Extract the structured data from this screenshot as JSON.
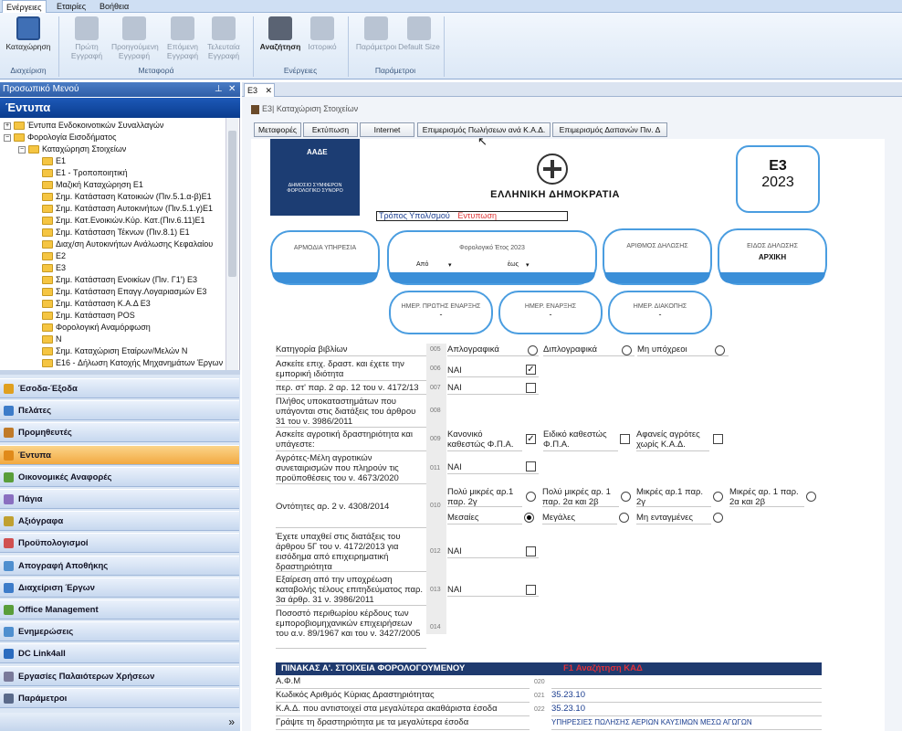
{
  "ribbon": {
    "tabs": [
      "Ενέργειες",
      "Εταιρίες",
      "Βοήθεια"
    ],
    "buttons": {
      "save": "Καταχώρηση",
      "first": "Πρώτη Εγγραφή",
      "prev": "Προηγούμενη Εγγραφή",
      "next": "Επόμενη Εγγραφή",
      "last": "Τελευταία Εγγραφή",
      "search": "Αναζήτηση",
      "history": "Ιστορικό",
      "params": "Παράμετροι",
      "default_size": "Default Size"
    },
    "groups": {
      "management": "Διαχείριση",
      "navigation": "Μεταφορά",
      "actions": "Ενέργειες",
      "parameters": "Παράμετροι"
    }
  },
  "left": {
    "header": "Προσωπικό Μενού",
    "pin": "ᵠ",
    "close": "✕",
    "section": "Έντυπα",
    "tree": {
      "root1": "Έντυπα Ενδοκοινοτικών Συναλλαγών",
      "root2": "Φορολογία Εισοδήματος",
      "sub": "Καταχώρηση Στοιχείων",
      "items": [
        "E1",
        "E1 - Τροποποιητική",
        "Μαζική Καταχώρηση E1",
        "Σημ. Κατάσταση Κατοικιών (Πιν.5.1.α-β)E1",
        "Σημ. Κατάσταση Αυτοκινήτων (Πιν.5.1.γ)E1",
        "Σημ. Κατ.Ενοικιών.Κύρ. Κατ.(Πιν.6.11)E1",
        "Σημ. Κατάσταση Τέκνων (Πιν.8.1) E1",
        "Διαχ/ση Αυτοκινήτων Ανάλωσης Κεφαλαίου",
        "E2",
        "E3",
        "Σημ. Κατάσταση Ενοικίων (Πιν. Γ1') Ε3",
        "Σημ. Κατάσταση Επαγγ.Λογαριασμών Ε3",
        "Σημ. Κατάσταση Κ.Α.Δ Ε3",
        "Σημ. Κατάσταση POS",
        "Φορολογική Αναμόρφωση",
        "N",
        "Σημ. Καταχώριση Εταίρων/Μελών Ν",
        "E16 - Δήλωση Κατοχής Μηχανημάτων Έργων"
      ]
    },
    "nav": [
      "Έσοδα-Έξοδα",
      "Πελάτες",
      "Προμηθευτές",
      "Έντυπα",
      "Οικονομικές Αναφορές",
      "Πάγια",
      "Αξιόγραφα",
      "Προϋπολογισμοί",
      "Απογραφή Αποθήκης",
      "Διαχείριση Έργων",
      "Office Management",
      "Ενημερώσεις",
      "DC Link4all",
      "Εργασίες Παλαιότερων Χρήσεων",
      "Παράμετροι"
    ],
    "bottom_arrow": "»"
  },
  "doc": {
    "tab": "E3",
    "close": "✕",
    "title": "Ε3| Καταχώριση Στοιχείων",
    "toolbar": [
      "Μεταφορές",
      "Εκτύπωση",
      "Internet",
      "Επιμερισμός Πωλήσεων ανά Κ.Α.Δ.",
      "Επιμερισμός Δαπανών Πιν. Δ"
    ]
  },
  "form": {
    "aade": "ΑΑΔΕ",
    "aade_sub": "ΔΗΜΟΣΙΟ ΣΥΜΦΕΡΟΝ ΦΟΡΟΛΟΓΙΚΟ ΣΥΝΟΡΟ",
    "republic": "ΕΛΛΗΝΙΚΗ ΔΗΜΟΚΡΑΤΙΑ",
    "form_code": "Ε3",
    "year": "2023",
    "payment_label": "Τρόπος Υπολ/σμού",
    "payment_value": "Εντυπωση",
    "pills": {
      "service": "ΑΡΜΟΔΙΑ ΥΠΗΡΕΣΙΑ",
      "tax_year": "Φορολογικό Έτος 2023",
      "from": "Από",
      "to": "έως",
      "decl_no": "ΑΡΙΘΜΟΣ ΔΗΛΩΣΗΣ",
      "decl_type": "ΕΙΔΟΣ ΔΗΛΩΣΗΣ",
      "decl_type_val": "ΑΡΧΙΚΗ",
      "start_date": "ΗΜΕΡ. ΠΡΩΤΗΣ ΕΝΑΡΞΗΣ",
      "resume_date": "ΗΜΕΡ. ΕΝΑΡΞΗΣ",
      "stop_date": "ΗΜΕΡ. ΔΙΑΚΟΠΗΣ",
      "dash": "-"
    },
    "rows": {
      "r005": {
        "label": "Κατηγορία βιβλίων",
        "num": "005",
        "opt1": "Απλογραφικά",
        "opt2": "Διπλογραφικά",
        "opt3": "Μη υπόχρεοι"
      },
      "r006": {
        "label": "Ασκείτε επιχ. δραστ. και έχετε την εμπορική ιδιότητα",
        "num": "006",
        "yes": "ΝΑΙ"
      },
      "r007": {
        "label": "περ. στ' παρ. 2 αρ. 12 του ν. 4172/13",
        "num": "007",
        "yes": "ΝΑΙ"
      },
      "r008": {
        "label": "Πλήθος υποκαταστημάτων που υπάγονται στις διατάξεις του άρθρου 31 του ν. 3986/2011",
        "num": "008"
      },
      "r009": {
        "label": "Ασκείτε αγροτική δραστηριότητα και υπάγεστε:",
        "num": "009",
        "opt1": "Κανονικό καθεστώς Φ.Π.Α.",
        "opt2": "Ειδικό καθεστώς Φ.Π.Α.",
        "opt3": "Αφανείς αγρότες χωρίς Κ.Α.Δ."
      },
      "r011": {
        "label": "Αγρότες-Μέλη αγροτικών συνεταιρισμών που πληρούν τις προϋποθέσεις του ν. 4673/2020",
        "num": "011",
        "yes": "ΝΑΙ"
      },
      "r010": {
        "label": "Οντότητες αρ. 2 ν. 4308/2014",
        "num": "010",
        "o1": "Πολύ μικρές αρ.1 παρ. 2γ",
        "o2": "Πολύ μικρές αρ. 1 παρ. 2α και 2β",
        "o3": "Μικρές αρ.1 παρ. 2γ",
        "o4": "Μικρές αρ. 1 παρ. 2α και 2β",
        "o5": "Μεσαίες",
        "o6": "Μεγάλες",
        "o7": "Μη ενταγμένες"
      },
      "r012": {
        "label": "Έχετε υπαχθεί στις διατάξεις του άρθρου 5Γ του ν. 4172/2013 για εισόδημα από επιχειρηματική δραστηριότητα",
        "num": "012",
        "yes": "ΝΑΙ"
      },
      "r013": {
        "label": "Εξαίρεση από την υποχρέωση καταβολής τέλους επιτηδεύματος παρ. 3α άρθρ. 31 ν. 3986/2011",
        "num": "013",
        "yes": "ΝΑΙ"
      },
      "r014": {
        "label": "Ποσοστό περιθωρίου κέρδους των εμποροβιομηχανικών επιχειρήσεων του α.ν. 89/1967 και του ν. 3427/2005",
        "num": "014"
      }
    },
    "table_a": {
      "title": "ΠΙΝΑΚΑΣ Α'. ΣΤΟΙΧΕΙΑ ΦΟΡΟΛΟΓΟΥΜΕΝΟΥ",
      "hint": "F1 Αναζήτηση ΚΑΔ",
      "rows": [
        {
          "label": "Α.Φ.Μ",
          "num": "020",
          "value": ""
        },
        {
          "label": "Κωδικός Αριθμός Κύριας Δραστηριότητας",
          "num": "021",
          "value": "35.23.10"
        },
        {
          "label": "Κ.Α.Δ. που αντιστοιχεί στα μεγαλύτερα ακαθάριστα έσοδα",
          "num": "022",
          "value": "35.23.10"
        },
        {
          "label": "Γράψτε τη δραστηριότητα με τα μεγαλύτερα έσοδα",
          "num": "",
          "value": "ΥΠΗΡΕΣΙΕΣ ΠΩΛΗΣΗΣ ΑΕΡΙΩΝ ΚΑΥΣΙΜΩΝ ΜΕΣΩ ΑΓΩΓΩΝ"
        }
      ]
    }
  }
}
